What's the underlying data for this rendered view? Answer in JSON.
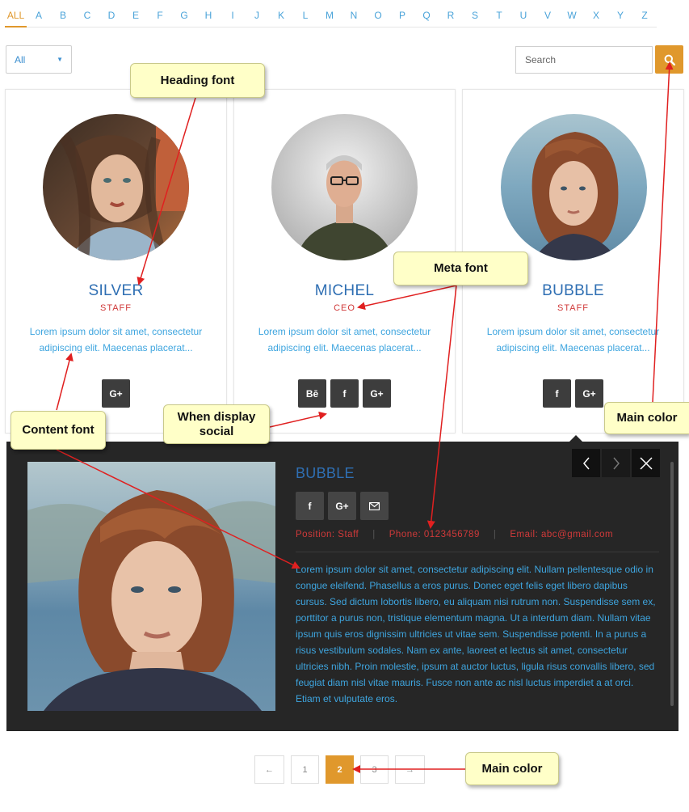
{
  "alphabet": [
    "ALL",
    "A",
    "B",
    "C",
    "D",
    "E",
    "F",
    "G",
    "H",
    "I",
    "J",
    "K",
    "L",
    "M",
    "N",
    "O",
    "P",
    "Q",
    "R",
    "S",
    "T",
    "U",
    "V",
    "W",
    "X",
    "Y",
    "Z"
  ],
  "filter": {
    "selected": "All"
  },
  "search": {
    "placeholder": "Search"
  },
  "cards": [
    {
      "name": "SILVER",
      "role": "STAFF",
      "desc": "Lorem ipsum dolor sit amet, consectetur adipiscing elit. Maecenas placerat...",
      "socials": [
        "G+"
      ]
    },
    {
      "name": "MICHEL",
      "role": "CEO",
      "desc": "Lorem ipsum dolor sit amet, consectetur adipiscing elit. Maecenas placerat...",
      "socials": [
        "Bē",
        "f",
        "G+"
      ]
    },
    {
      "name": "BUBBLE",
      "role": "STAFF",
      "desc": "Lorem ipsum dolor sit amet, consectetur adipiscing elit. Maecenas placerat...",
      "socials": [
        "f",
        "G+"
      ]
    }
  ],
  "detail": {
    "name": "BUBBLE",
    "position": "Position: Staff",
    "phone": "Phone: 0123456789",
    "email": "Email: abc@gmail.com",
    "bio": "Lorem ipsum dolor sit amet, consectetur adipiscing elit. Nullam pellentesque odio in congue eleifend. Phasellus a eros purus. Donec eget felis eget libero dapibus cursus. Sed dictum lobortis libero, eu aliquam nisi rutrum non. Suspendisse sem ex, porttitor a purus non, tristique elementum magna. Ut a interdum diam. Nullam vitae ipsum quis eros dignissim ultricies ut vitae sem. Suspendisse potenti. In a purus a risus vestibulum sodales. Nam ex ante, laoreet et lectus sit amet, consectetur ultricies nibh. Proin molestie, ipsum at auctor luctus, ligula risus convallis libero, sed feugiat diam nisl vitae mauris. Fusce non ante ac nisl luctus imperdiet a at orci. Etiam et vulputate eros."
  },
  "pagination": {
    "prev": "←",
    "pages": [
      "1",
      "2",
      "3"
    ],
    "current": "2",
    "next": "→"
  },
  "callouts": {
    "heading_font": "Heading font",
    "meta_font": "Meta font",
    "content_font": "Content font",
    "when_display_social": "When display social",
    "main_color_top": "Main color",
    "main_color_bottom": "Main color"
  },
  "colors": {
    "main": "#e0982c",
    "heading": "#2f6fb3",
    "meta": "#d03a3a",
    "content": "#3ea5df",
    "panel": "#262626"
  }
}
